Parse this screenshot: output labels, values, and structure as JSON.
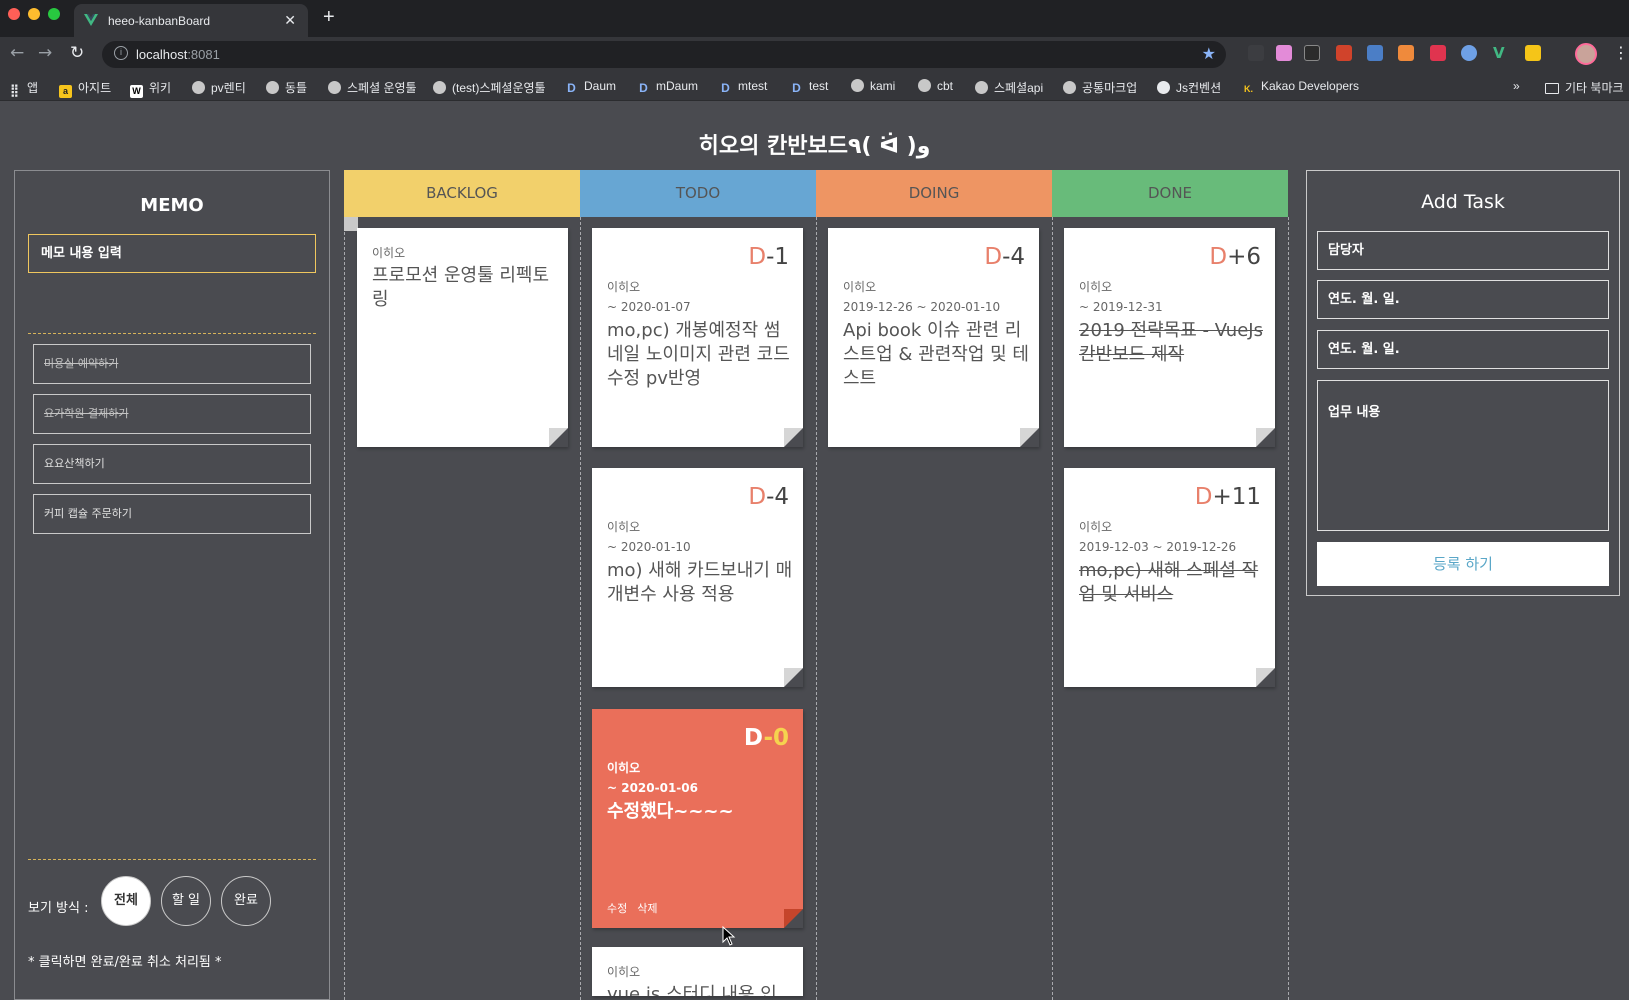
{
  "browser": {
    "tab_title": "heeo-kanbanBoard",
    "url_host": "localhost",
    "url_port": ":8081",
    "bookmarks": [
      {
        "label": "앱",
        "icon": "apps-grid-icon"
      },
      {
        "label": "아지트",
        "icon": "agit-icon"
      },
      {
        "label": "위키",
        "icon": "wiki-icon"
      },
      {
        "label": "pv렌티",
        "icon": "globe-icon"
      },
      {
        "label": "동틀",
        "icon": "globe-icon"
      },
      {
        "label": "스페셜 운영툴",
        "icon": "globe-icon"
      },
      {
        "label": "(test)스페셜운영툴",
        "icon": "globe-icon"
      },
      {
        "label": "Daum",
        "icon": "daum-icon"
      },
      {
        "label": "mDaum",
        "icon": "daum-icon"
      },
      {
        "label": "mtest",
        "icon": "daum-icon"
      },
      {
        "label": "test",
        "icon": "daum-icon"
      },
      {
        "label": "kami",
        "icon": "globe-icon"
      },
      {
        "label": "cbt",
        "icon": "globe-icon"
      },
      {
        "label": "스페셜api",
        "icon": "globe-icon"
      },
      {
        "label": "공통마크업",
        "icon": "globe-icon"
      },
      {
        "label": "Js컨벤션",
        "icon": "github-icon"
      },
      {
        "label": "Kakao Developers",
        "icon": "kakao-icon"
      }
    ],
    "other_bookmarks": "기타 북마크",
    "overflow": "»"
  },
  "app": {
    "title": "히오의 칸반보드٩( ᐛ )و"
  },
  "memo": {
    "title": "MEMO",
    "input_placeholder": "메모 내용 입력",
    "items": [
      {
        "text": "미용실 예약하기",
        "done": true
      },
      {
        "text": "요가학원 결제하기",
        "done": true
      },
      {
        "text": "요요산책하기",
        "done": false
      },
      {
        "text": "커피 캡슐 주문하기",
        "done": false
      }
    ],
    "view_label": "보기 방식 :",
    "view_options": [
      "전체",
      "할 일",
      "완료"
    ],
    "note": "* 클릭하면 완료/완료 취소 처리됨 *"
  },
  "columns": [
    {
      "name": "BACKLOG",
      "color": "#f2d06b"
    },
    {
      "name": "TODO",
      "color": "#67a6d3"
    },
    {
      "name": "DOING",
      "color": "#ee9563"
    },
    {
      "name": "DONE",
      "color": "#68bb7a"
    }
  ],
  "cards": {
    "backlog": [
      {
        "owner": "이히오",
        "text": "프로모션 운영툴 리펙토링"
      }
    ],
    "todo": [
      {
        "dday_prefix": "D",
        "dday_value": "-1",
        "owner": "이히오",
        "date": "~ 2020-01-07",
        "text": "mo,pc) 개봉예정작 썸네일 노이미지 관련 코드수정 pv반영"
      },
      {
        "dday_prefix": "D",
        "dday_value": "-4",
        "owner": "이히오",
        "date": "~ 2020-01-10",
        "text": "mo) 새해 카드보내기 매개변수 사용 적용"
      },
      {
        "dday_prefix": "D",
        "dday_value": "-0",
        "owner": "이히오",
        "date": "~ 2020-01-06",
        "text": "수정했다~~~~",
        "edit": "수정",
        "delete": "삭제"
      },
      {
        "owner": "이히오",
        "text": "vue.js 스터디 내용 인"
      }
    ],
    "doing": [
      {
        "dday_prefix": "D",
        "dday_value": "-4",
        "owner": "이히오",
        "date": "2019-12-26 ~ 2020-01-10",
        "text": "Api book 이슈 관련 리스트업 & 관련작업 및 테스트"
      }
    ],
    "done": [
      {
        "dday_prefix": "D",
        "dday_value": "+6",
        "owner": "이히오",
        "date": "~ 2019-12-31",
        "text": "2019 전략목표 - VueJs 칸반보드 제작"
      },
      {
        "dday_prefix": "D",
        "dday_value": "+11",
        "owner": "이히오",
        "date": "2019-12-03 ~ 2019-12-26",
        "text": "mo,pc) 새해 스페셜 작업 및 서비스"
      }
    ]
  },
  "add_task": {
    "title": "Add Task",
    "owner_placeholder": "담당자",
    "start_placeholder": "연도. 월. 일.",
    "end_placeholder": "연도. 월. 일.",
    "content_placeholder": "업무 내용",
    "submit_label": "등록 하기"
  }
}
